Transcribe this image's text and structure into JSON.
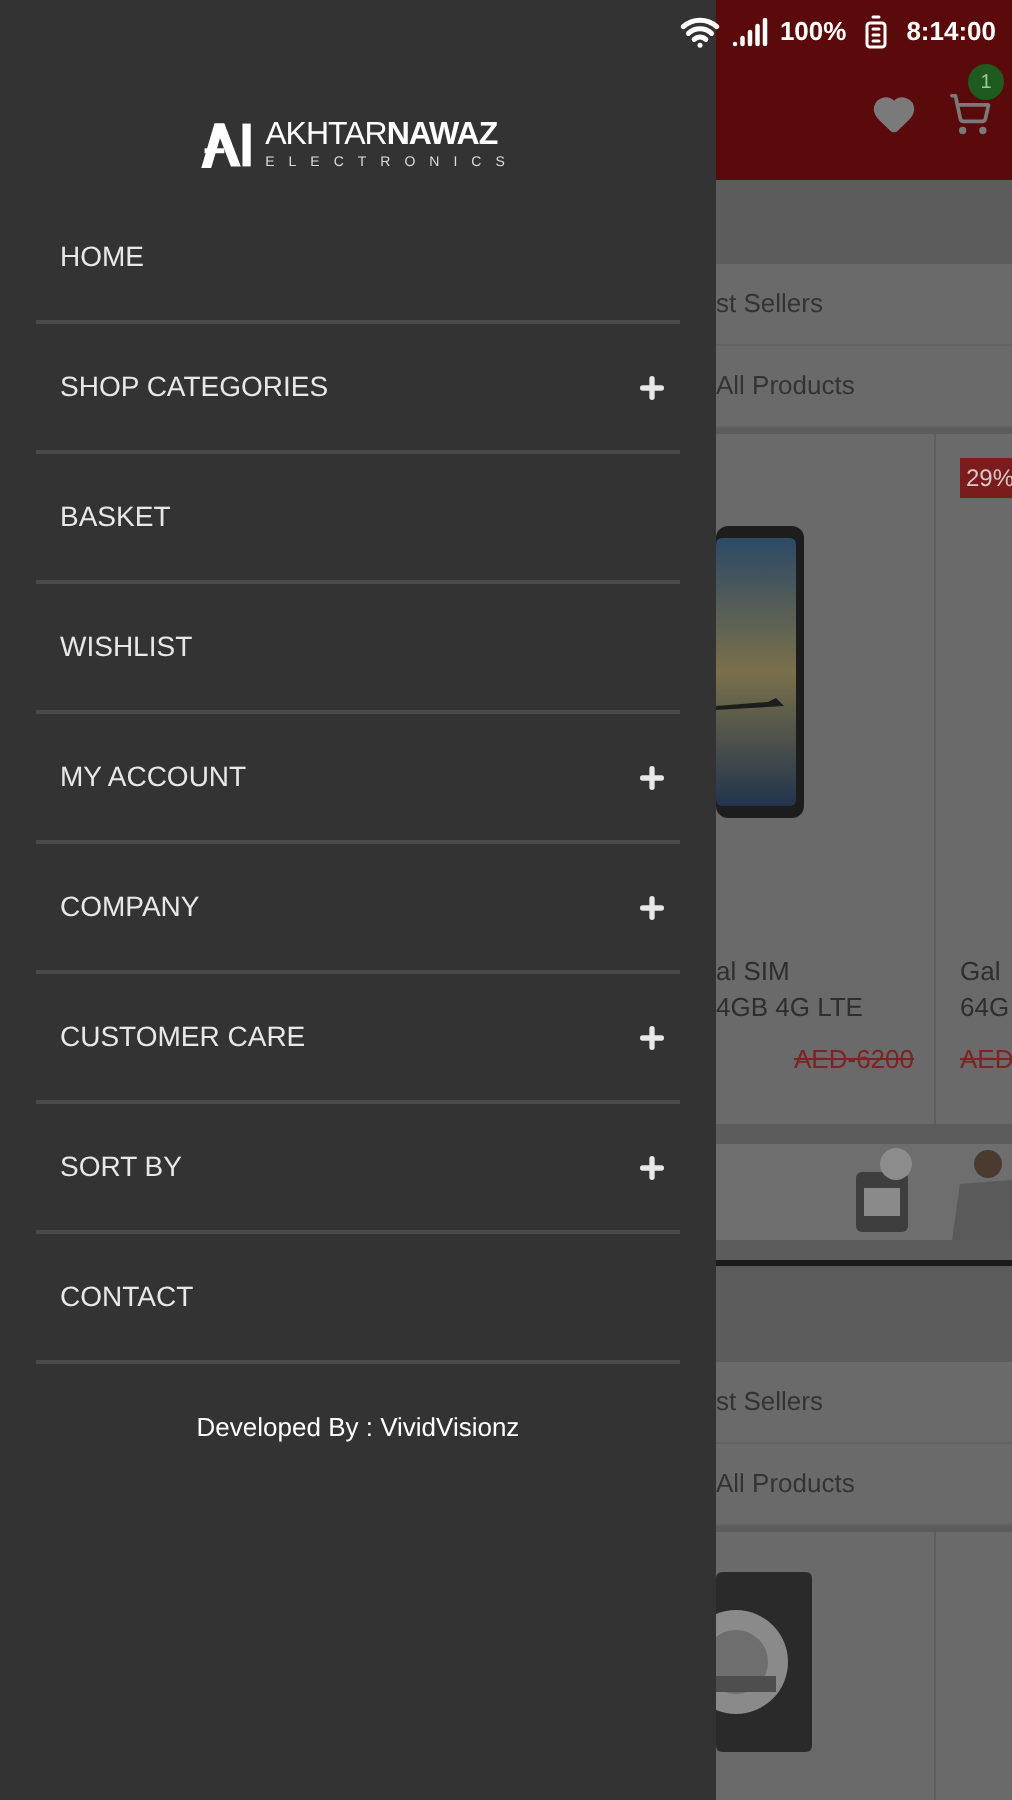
{
  "status_bar": {
    "battery": "100%",
    "time": "8:14:00"
  },
  "drawer": {
    "logo": {
      "name_light": "AKHTAR",
      "name_bold": "NAWAZ",
      "tagline": "ELECTRONICS"
    },
    "items": [
      {
        "label": "HOME",
        "expandable": false
      },
      {
        "label": "SHOP CATEGORIES",
        "expandable": true
      },
      {
        "label": "BASKET",
        "expandable": false
      },
      {
        "label": "WISHLIST",
        "expandable": false
      },
      {
        "label": "MY ACCOUNT",
        "expandable": true
      },
      {
        "label": "COMPANY",
        "expandable": true
      },
      {
        "label": "CUSTOMER CARE",
        "expandable": true
      },
      {
        "label": "SORT BY",
        "expandable": true
      },
      {
        "label": "CONTACT",
        "expandable": false
      }
    ],
    "footer": "Developed By : VividVisionz"
  },
  "app_header": {
    "cart_count": "1"
  },
  "sections": [
    {
      "links": [
        "st Sellers",
        "All Products"
      ],
      "products": [
        {
          "kind": "phone",
          "name_lines": [
            "al SIM",
            "4GB 4G LTE"
          ],
          "old_price": "AED-6200"
        },
        {
          "kind": "partial",
          "badge": "29%",
          "name_lines": [
            "Gal",
            "64G"
          ],
          "old_price": "AED"
        }
      ],
      "banner": true
    },
    {
      "links": [
        "st Sellers",
        "All Products"
      ],
      "products": [
        {
          "kind": "box"
        },
        {
          "kind": "partial"
        }
      ],
      "banner": false
    }
  ]
}
